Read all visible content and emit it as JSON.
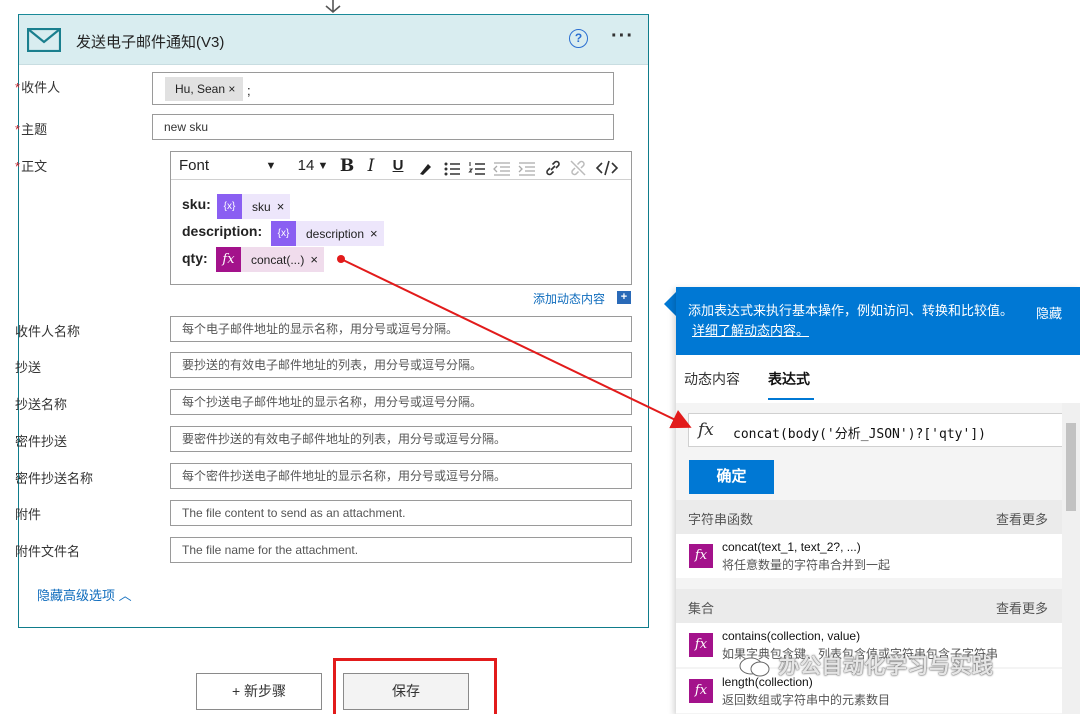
{
  "card": {
    "title": "发送电子邮件通知(V3)",
    "help": "?",
    "more": "···",
    "fields": {
      "to": {
        "label": "收件人",
        "recipient": "Hu, Sean",
        "sep": ";"
      },
      "subject": {
        "label": "主题",
        "value": "new sku"
      },
      "body": {
        "label": "正文"
      },
      "to_names": {
        "label": "收件人名称",
        "placeholder": "每个电子邮件地址的显示名称，用分号或逗号分隔。"
      },
      "cc": {
        "label": "抄送",
        "placeholder": "要抄送的有效电子邮件地址的列表，用分号或逗号分隔。"
      },
      "cc_names": {
        "label": "抄送名称",
        "placeholder": "每个抄送电子邮件地址的显示名称，用分号或逗号分隔。"
      },
      "bcc": {
        "label": "密件抄送",
        "placeholder": "要密件抄送的有效电子邮件地址的列表，用分号或逗号分隔。"
      },
      "bcc_names": {
        "label": "密件抄送名称",
        "placeholder": "每个密件抄送电子邮件地址的显示名称，用分号或逗号分隔。"
      },
      "attachment": {
        "label": "附件",
        "placeholder": "The file content to send as an attachment."
      },
      "attachment_name": {
        "label": "附件文件名",
        "placeholder": "The file name for the attachment."
      }
    },
    "required_mark": "*",
    "toolbar": {
      "font": "Font",
      "size": "14",
      "bold": "B",
      "italic": "I",
      "underline": "U"
    },
    "body_lines": [
      {
        "label": "sku:",
        "token": "sku",
        "token_icon": "{x}"
      },
      {
        "label": "description:",
        "token": "description",
        "token_icon": "{x}"
      },
      {
        "label": "qty:",
        "token": "concat(...)",
        "token_icon": "fx"
      }
    ],
    "token_close": "×",
    "add_dynamic": "添加动态内容",
    "add_dynamic_icon": "+",
    "hide_advanced": "隐藏高级选项",
    "hide_advanced_chevron": "︿"
  },
  "buttons": {
    "new_step": "+ 新步骤",
    "save": "保存"
  },
  "panel": {
    "banner_text": "添加表达式来执行基本操作，例如访问、转换和比较值。",
    "banner_link": "详细了解动态内容。",
    "banner_hide": "隐藏",
    "tabs": [
      "动态内容",
      "表达式"
    ],
    "active_tab": 1,
    "expression": "concat(body('分析_JSON')?['qty'])",
    "fx": "fx",
    "ok": "确定",
    "sections": [
      {
        "title": "字符串函数",
        "more": "查看更多",
        "items": [
          {
            "name": "concat(text_1, text_2?, ...)",
            "desc": "将任意数量的字符串合并到一起"
          }
        ]
      },
      {
        "title": "集合",
        "more": "查看更多",
        "items": [
          {
            "name": "contains(collection, value)",
            "desc": "如果字典包含键、列表包含值或字符串包含子字符串"
          },
          {
            "name": "length(collection)",
            "desc": "返回数组或字符串中的元素数目"
          }
        ]
      }
    ]
  },
  "watermark": "办公自动化学习与实践",
  "colors": {
    "accent": "#0078d4",
    "arrow": "#e21b1b",
    "fx_token": "#a3128b",
    "dyn_token": "#8a5ff2",
    "card_border": "#0f7c8b"
  }
}
